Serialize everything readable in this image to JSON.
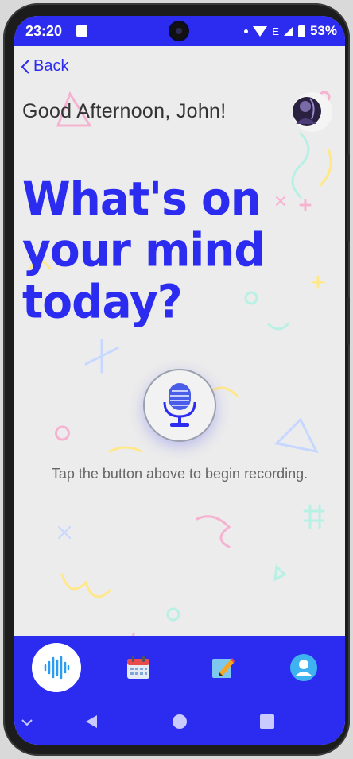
{
  "status_bar": {
    "time": "23:20",
    "network": "E",
    "battery": "53%"
  },
  "back": {
    "label": "Back"
  },
  "greeting": "Good Afternoon, John!",
  "headline": "What's on your mind today?",
  "helper_text": "Tap the button above to begin recording.",
  "tabs": [
    {
      "icon": "soundwave-icon",
      "active": true
    },
    {
      "icon": "calendar-icon",
      "active": false
    },
    {
      "icon": "note-pencil-icon",
      "active": false
    },
    {
      "icon": "profile-icon",
      "active": false
    }
  ],
  "colors": {
    "primary": "#2b2cf0",
    "background": "#ececec"
  }
}
